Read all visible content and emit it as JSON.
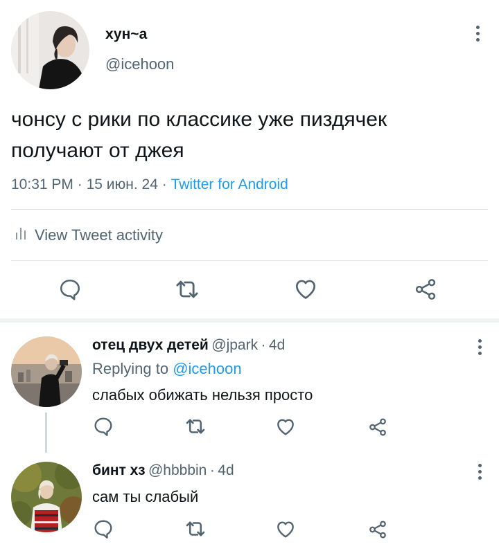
{
  "main_tweet": {
    "author_name": "хун~а",
    "author_handle": "@icehoon",
    "text_line1": "чонсу с рики по классике уже пиздячек",
    "text_line2": "получают от джея",
    "time": "10:31 PM",
    "date": "15 июн. 24",
    "separator": "·",
    "source": "Twitter for Android",
    "activity_label": "View Tweet activity"
  },
  "replies": [
    {
      "author_name": "отец двух детей",
      "author_handle": "@jpark",
      "age": "4d",
      "separator": "·",
      "replying_prefix": "Replying to",
      "replying_handle": "@icehoon",
      "text": "слабых обижать нельзя просто"
    },
    {
      "author_name": "бинт хз",
      "author_handle": "@hbbbin",
      "age": "4d",
      "separator": "·",
      "text": "сам ты слабый"
    }
  ],
  "colors": {
    "accent": "#1d9bf0",
    "muted": "#536471",
    "text": "#0f1419",
    "divider": "#e1e4e8"
  },
  "icons": [
    "more-icon",
    "analytics-icon",
    "reply-icon",
    "retweet-icon",
    "like-icon",
    "share-icon"
  ]
}
